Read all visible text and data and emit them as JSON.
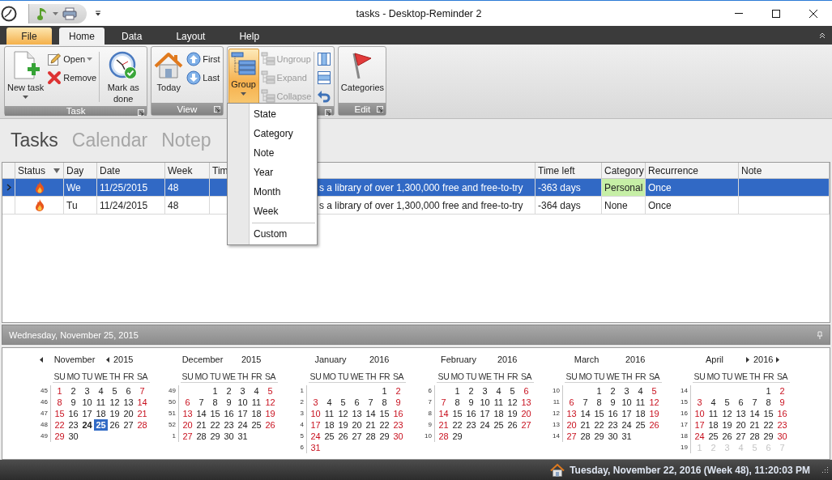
{
  "window": {
    "title": "tasks - Desktop-Reminder 2"
  },
  "ribbon": {
    "tabs": [
      {
        "label": "File",
        "kind": "file",
        "selected": false
      },
      {
        "label": "Home",
        "kind": "tab",
        "selected": true
      },
      {
        "label": "Data",
        "kind": "tab",
        "selected": false
      },
      {
        "label": "Layout",
        "kind": "tab",
        "selected": false
      },
      {
        "label": "Help",
        "kind": "tab",
        "selected": false
      }
    ],
    "groups": [
      {
        "label": "Task",
        "items": [
          {
            "label": "New task",
            "kind": "large",
            "dropdown": true,
            "disabled": false,
            "active": false
          },
          {
            "label": "Open",
            "kind": "small",
            "dropdown": true,
            "disabled": false,
            "active": false
          },
          {
            "label": "Remove",
            "kind": "small",
            "disabled": false,
            "active": false
          },
          {
            "label": "Mark as done",
            "kind": "large",
            "separator_before": true,
            "disabled": false,
            "active": false
          }
        ]
      },
      {
        "label": "View",
        "items": [
          {
            "label": "Today",
            "kind": "large",
            "disabled": false,
            "active": false
          },
          {
            "label": "First",
            "kind": "small",
            "disabled": false,
            "active": false
          },
          {
            "label": "Last",
            "kind": "small",
            "disabled": false,
            "active": false
          }
        ]
      },
      {
        "items": [
          {
            "label": "Group",
            "kind": "large",
            "dropdown": true,
            "disabled": false,
            "active": true
          },
          {
            "label": "Ungroup",
            "kind": "small",
            "disabled": true,
            "active": false
          },
          {
            "label": "Expand",
            "kind": "small",
            "disabled": true,
            "active": false
          },
          {
            "label": "Collapse",
            "kind": "small",
            "disabled": true,
            "active": false
          },
          {
            "kind": "icon",
            "separator_before": true,
            "disabled": false,
            "active": false
          },
          {
            "kind": "icon",
            "disabled": false,
            "active": false
          },
          {
            "kind": "icon",
            "disabled": false,
            "active": false
          }
        ]
      },
      {
        "label": "Edit",
        "items": [
          {
            "label": "Categories",
            "kind": "large",
            "disabled": false,
            "active": false
          }
        ]
      }
    ]
  },
  "view_tabs": [
    {
      "label": "Tasks",
      "selected": true
    },
    {
      "label": "Calendar",
      "selected": false
    },
    {
      "label": "Notep",
      "selected": false
    }
  ],
  "table": {
    "columns": [
      {
        "label": "Status",
        "filter": true
      },
      {
        "label": "Day"
      },
      {
        "label": "Date"
      },
      {
        "label": "Week"
      },
      {
        "label": "Tim"
      },
      {
        "label": "Time left"
      },
      {
        "label": "Category"
      },
      {
        "label": "Recurrence"
      },
      {
        "label": "Note"
      }
    ],
    "rows": [
      {
        "selected": true,
        "day": "We",
        "date": "11/25/2015",
        "week": "48",
        "text": "s a library of over 1,300,000 free and free-to-try",
        "time_left": "-363 days",
        "category": {
          "label": "Personal",
          "color": "#c6efa6"
        },
        "recurrence": "Once"
      },
      {
        "selected": false,
        "day": "Tu",
        "date": "11/24/2015",
        "week": "48",
        "text": "s a library of over 1,300,000 free and free-to-try",
        "time_left": "-364 days",
        "category": {
          "label": "None"
        },
        "recurrence": "Once"
      }
    ]
  },
  "group_menu": {
    "items": [
      {
        "label": "State"
      },
      {
        "label": "Category"
      },
      {
        "label": "Note"
      },
      {
        "label": "Year"
      },
      {
        "label": "Month"
      },
      {
        "label": "Week"
      },
      {
        "label": "Custom",
        "separator_before": true
      }
    ]
  },
  "calendar": {
    "header": "Wednesday, November 25, 2015",
    "months": [
      {
        "name": "November",
        "year": "2015",
        "kind": "first",
        "weekdays": [
          "SU",
          "MO",
          "TU",
          "WE",
          "TH",
          "FR",
          "SA"
        ],
        "weeks": [
          {
            "week": "45",
            "days": [
              {
                "n": "1",
                "selected": false
              },
              {
                "n": "2",
                "selected": false
              },
              {
                "n": "3",
                "selected": false
              },
              {
                "n": "4",
                "selected": false
              },
              {
                "n": "5",
                "selected": false
              },
              {
                "n": "6",
                "selected": false
              },
              {
                "n": "7",
                "selected": false
              }
            ]
          },
          {
            "week": "46",
            "days": [
              {
                "n": "8",
                "selected": false
              },
              {
                "n": "9",
                "selected": false
              },
              {
                "n": "10",
                "selected": false
              },
              {
                "n": "11",
                "selected": false
              },
              {
                "n": "12",
                "selected": false
              },
              {
                "n": "13",
                "selected": false
              },
              {
                "n": "14",
                "selected": false
              }
            ]
          },
          {
            "week": "47",
            "days": [
              {
                "n": "15",
                "selected": false
              },
              {
                "n": "16",
                "selected": false
              },
              {
                "n": "17",
                "selected": false
              },
              {
                "n": "18",
                "selected": false
              },
              {
                "n": "19",
                "selected": false
              },
              {
                "n": "20",
                "selected": false
              },
              {
                "n": "21",
                "selected": false
              }
            ]
          },
          {
            "week": "48",
            "days": [
              {
                "n": "22",
                "selected": false
              },
              {
                "n": "23",
                "selected": false
              },
              {
                "n": "24",
                "selected": false,
                "today": true
              },
              {
                "n": "25",
                "selected": true
              },
              {
                "n": "26",
                "selected": false
              },
              {
                "n": "27",
                "selected": false
              },
              {
                "n": "28",
                "selected": false
              }
            ]
          },
          {
            "week": "49",
            "days": [
              {
                "n": "29",
                "selected": false
              },
              {
                "n": "30",
                "selected": false
              }
            ]
          }
        ]
      },
      {
        "name": "December",
        "year": "2015",
        "kind": "middle",
        "weekdays": [
          "SU",
          "MO",
          "TU",
          "WE",
          "TH",
          "FR",
          "SA"
        ],
        "weeks": [
          {
            "week": "49",
            "days": [
              {
                "n": "1",
                "selected": false
              },
              {
                "n": "2",
                "selected": false
              },
              {
                "n": "3",
                "selected": false
              },
              {
                "n": "4",
                "selected": false
              },
              {
                "n": "5",
                "selected": false
              }
            ]
          },
          {
            "week": "50",
            "days": [
              {
                "n": "6",
                "selected": false
              },
              {
                "n": "7",
                "selected": false
              },
              {
                "n": "8",
                "selected": false
              },
              {
                "n": "9",
                "selected": false
              },
              {
                "n": "10",
                "selected": false
              },
              {
                "n": "11",
                "selected": false
              },
              {
                "n": "12",
                "selected": false
              }
            ]
          },
          {
            "week": "51",
            "days": [
              {
                "n": "13",
                "selected": false
              },
              {
                "n": "14",
                "selected": false
              },
              {
                "n": "15",
                "selected": false
              },
              {
                "n": "16",
                "selected": false
              },
              {
                "n": "17",
                "selected": false
              },
              {
                "n": "18",
                "selected": false
              },
              {
                "n": "19",
                "selected": false
              }
            ]
          },
          {
            "week": "52",
            "days": [
              {
                "n": "20",
                "selected": false
              },
              {
                "n": "21",
                "selected": false
              },
              {
                "n": "22",
                "selected": false
              },
              {
                "n": "23",
                "selected": false
              },
              {
                "n": "24",
                "selected": false
              },
              {
                "n": "25",
                "selected": false
              },
              {
                "n": "26",
                "selected": false
              }
            ]
          },
          {
            "week": "1",
            "days": [
              {
                "n": "27",
                "selected": false
              },
              {
                "n": "28",
                "selected": false
              },
              {
                "n": "29",
                "selected": false
              },
              {
                "n": "30",
                "selected": false
              },
              {
                "n": "31",
                "selected": false
              }
            ]
          }
        ]
      },
      {
        "name": "January",
        "year": "2016",
        "kind": "middle",
        "weekdays": [
          "SU",
          "MO",
          "TU",
          "WE",
          "TH",
          "FR",
          "SA"
        ],
        "weeks": [
          {
            "week": "1",
            "days": [
              {
                "n": "1",
                "selected": false
              },
              {
                "n": "2",
                "selected": false
              }
            ]
          },
          {
            "week": "2",
            "days": [
              {
                "n": "3",
                "selected": false
              },
              {
                "n": "4",
                "selected": false
              },
              {
                "n": "5",
                "selected": false
              },
              {
                "n": "6",
                "selected": false
              },
              {
                "n": "7",
                "selected": false
              },
              {
                "n": "8",
                "selected": false
              },
              {
                "n": "9",
                "selected": false
              }
            ]
          },
          {
            "week": "3",
            "days": [
              {
                "n": "10",
                "selected": false
              },
              {
                "n": "11",
                "selected": false
              },
              {
                "n": "12",
                "selected": false
              },
              {
                "n": "13",
                "selected": false
              },
              {
                "n": "14",
                "selected": false
              },
              {
                "n": "15",
                "selected": false
              },
              {
                "n": "16",
                "selected": false
              }
            ]
          },
          {
            "week": "4",
            "days": [
              {
                "n": "17",
                "selected": false
              },
              {
                "n": "18",
                "selected": false
              },
              {
                "n": "19",
                "selected": false
              },
              {
                "n": "20",
                "selected": false
              },
              {
                "n": "21",
                "selected": false
              },
              {
                "n": "22",
                "selected": false
              },
              {
                "n": "23",
                "selected": false
              }
            ]
          },
          {
            "week": "5",
            "days": [
              {
                "n": "24",
                "selected": false
              },
              {
                "n": "25",
                "selected": false
              },
              {
                "n": "26",
                "selected": false
              },
              {
                "n": "27",
                "selected": false
              },
              {
                "n": "28",
                "selected": false
              },
              {
                "n": "29",
                "selected": false
              },
              {
                "n": "30",
                "selected": false
              }
            ]
          },
          {
            "week": "6",
            "days": [
              {
                "n": "31",
                "selected": false
              }
            ]
          }
        ]
      },
      {
        "name": "February",
        "year": "2016",
        "kind": "middle",
        "weekdays": [
          "SU",
          "MO",
          "TU",
          "WE",
          "TH",
          "FR",
          "SA"
        ],
        "weeks": [
          {
            "week": "6",
            "days": [
              {
                "n": "1",
                "selected": false
              },
              {
                "n": "2",
                "selected": false
              },
              {
                "n": "3",
                "selected": false
              },
              {
                "n": "4",
                "selected": false
              },
              {
                "n": "5",
                "selected": false
              },
              {
                "n": "6",
                "selected": false
              }
            ]
          },
          {
            "week": "7",
            "days": [
              {
                "n": "7",
                "selected": false
              },
              {
                "n": "8",
                "selected": false
              },
              {
                "n": "9",
                "selected": false
              },
              {
                "n": "10",
                "selected": false
              },
              {
                "n": "11",
                "selected": false
              },
              {
                "n": "12",
                "selected": false
              },
              {
                "n": "13",
                "selected": false
              }
            ]
          },
          {
            "week": "8",
            "days": [
              {
                "n": "14",
                "selected": false
              },
              {
                "n": "15",
                "selected": false
              },
              {
                "n": "16",
                "selected": false
              },
              {
                "n": "17",
                "selected": false
              },
              {
                "n": "18",
                "selected": false
              },
              {
                "n": "19",
                "selected": false
              },
              {
                "n": "20",
                "selected": false
              }
            ]
          },
          {
            "week": "9",
            "days": [
              {
                "n": "21",
                "selected": false
              },
              {
                "n": "22",
                "selected": false
              },
              {
                "n": "23",
                "selected": false
              },
              {
                "n": "24",
                "selected": false
              },
              {
                "n": "25",
                "selected": false
              },
              {
                "n": "26",
                "selected": false
              },
              {
                "n": "27",
                "selected": false
              }
            ]
          },
          {
            "week": "10",
            "days": [
              {
                "n": "28",
                "selected": false
              },
              {
                "n": "29",
                "selected": false
              }
            ]
          }
        ]
      },
      {
        "name": "March",
        "year": "2016",
        "kind": "middle",
        "weekdays": [
          "SU",
          "MO",
          "TU",
          "WE",
          "TH",
          "FR",
          "SA"
        ],
        "weeks": [
          {
            "week": "10",
            "days": [
              {
                "n": "1",
                "selected": false
              },
              {
                "n": "2",
                "selected": false
              },
              {
                "n": "3",
                "selected": false
              },
              {
                "n": "4",
                "selected": false
              },
              {
                "n": "5",
                "selected": false
              }
            ]
          },
          {
            "week": "11",
            "days": [
              {
                "n": "6",
                "selected": false
              },
              {
                "n": "7",
                "selected": false
              },
              {
                "n": "8",
                "selected": false
              },
              {
                "n": "9",
                "selected": false
              },
              {
                "n": "10",
                "selected": false
              },
              {
                "n": "11",
                "selected": false
              },
              {
                "n": "12",
                "selected": false
              }
            ]
          },
          {
            "week": "12",
            "days": [
              {
                "n": "13",
                "selected": false
              },
              {
                "n": "14",
                "selected": false
              },
              {
                "n": "15",
                "selected": false
              },
              {
                "n": "16",
                "selected": false
              },
              {
                "n": "17",
                "selected": false
              },
              {
                "n": "18",
                "selected": false
              },
              {
                "n": "19",
                "selected": false
              }
            ]
          },
          {
            "week": "13",
            "days": [
              {
                "n": "20",
                "selected": false
              },
              {
                "n": "21",
                "selected": false
              },
              {
                "n": "22",
                "selected": false
              },
              {
                "n": "23",
                "selected": false
              },
              {
                "n": "24",
                "selected": false
              },
              {
                "n": "25",
                "selected": false
              },
              {
                "n": "26",
                "selected": false
              }
            ]
          },
          {
            "week": "14",
            "days": [
              {
                "n": "27",
                "selected": false
              },
              {
                "n": "28",
                "selected": false
              },
              {
                "n": "29",
                "selected": false
              },
              {
                "n": "30",
                "selected": false
              },
              {
                "n": "31",
                "selected": false
              }
            ]
          }
        ]
      },
      {
        "name": "April",
        "year": "2016",
        "kind": "last",
        "weekdays": [
          "SU",
          "MO",
          "TU",
          "WE",
          "TH",
          "FR",
          "SA"
        ],
        "weeks": [
          {
            "week": "14",
            "days": [
              {
                "n": "1",
                "selected": false
              },
              {
                "n": "2",
                "selected": false
              }
            ]
          },
          {
            "week": "15",
            "days": [
              {
                "n": "3",
                "selected": false
              },
              {
                "n": "4",
                "selected": false
              },
              {
                "n": "5",
                "selected": false
              },
              {
                "n": "6",
                "selected": false
              },
              {
                "n": "7",
                "selected": false
              },
              {
                "n": "8",
                "selected": false
              },
              {
                "n": "9",
                "selected": false
              }
            ]
          },
          {
            "week": "16",
            "days": [
              {
                "n": "10",
                "selected": false
              },
              {
                "n": "11",
                "selected": false
              },
              {
                "n": "12",
                "selected": false
              },
              {
                "n": "13",
                "selected": false
              },
              {
                "n": "14",
                "selected": false
              },
              {
                "n": "15",
                "selected": false
              },
              {
                "n": "16",
                "selected": false
              }
            ]
          },
          {
            "week": "17",
            "days": [
              {
                "n": "17",
                "selected": false
              },
              {
                "n": "18",
                "selected": false
              },
              {
                "n": "19",
                "selected": false
              },
              {
                "n": "20",
                "selected": false
              },
              {
                "n": "21",
                "selected": false
              },
              {
                "n": "22",
                "selected": false
              },
              {
                "n": "23",
                "selected": false
              }
            ]
          },
          {
            "week": "18",
            "days": [
              {
                "n": "24",
                "selected": false
              },
              {
                "n": "25",
                "selected": false
              },
              {
                "n": "26",
                "selected": false
              },
              {
                "n": "27",
                "selected": false
              },
              {
                "n": "28",
                "selected": false
              },
              {
                "n": "29",
                "selected": false
              },
              {
                "n": "30",
                "selected": false
              }
            ]
          },
          {
            "week": "19",
            "days": [
              {
                "n": "1",
                "selected": false,
                "other_month": true
              },
              {
                "n": "2",
                "selected": false,
                "other_month": true
              },
              {
                "n": "3",
                "selected": false,
                "other_month": true
              },
              {
                "n": "4",
                "selected": false,
                "other_month": true
              },
              {
                "n": "5",
                "selected": false,
                "other_month": true
              },
              {
                "n": "6",
                "selected": false,
                "other_month": true
              },
              {
                "n": "7",
                "selected": false,
                "other_month": true
              }
            ]
          }
        ]
      }
    ]
  },
  "status_bar": {
    "text": "Tuesday, November 22, 2016 (Week 48), 11:20:03 PM"
  }
}
